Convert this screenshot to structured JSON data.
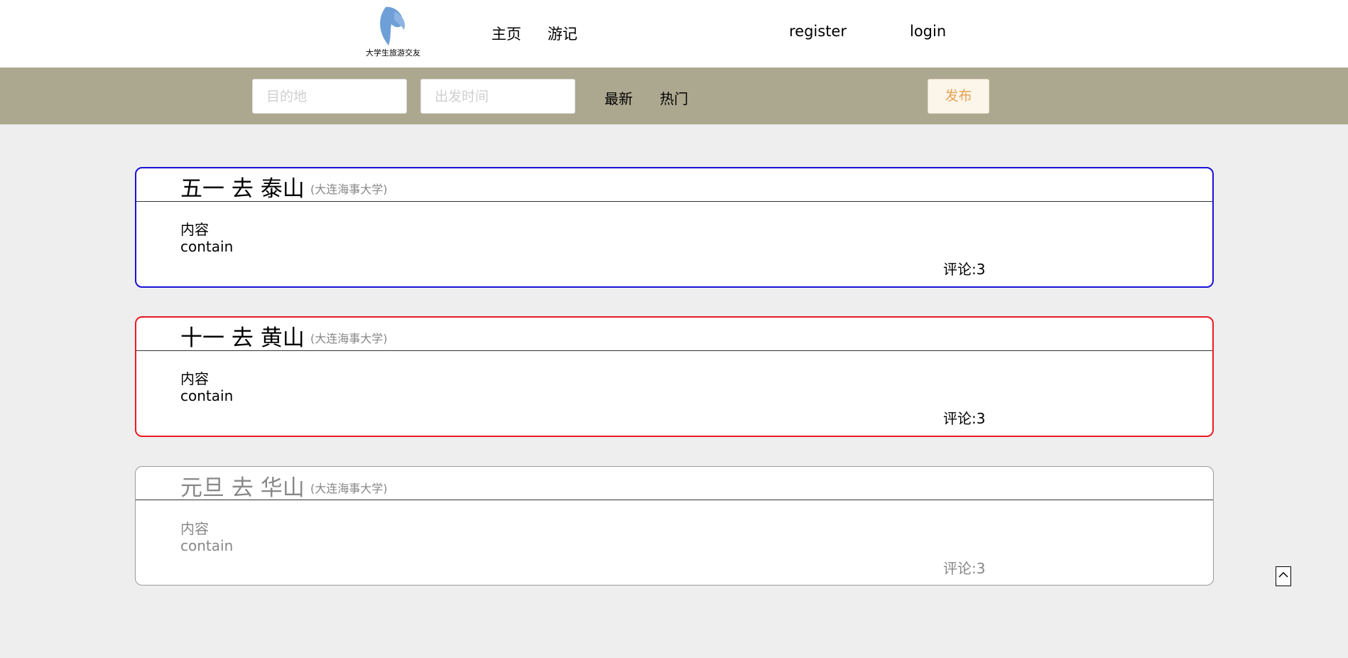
{
  "header": {
    "logo_text": "大学生旅游交友",
    "nav": [
      "主页",
      "游记"
    ],
    "register_label": "register",
    "login_label": "login"
  },
  "filter": {
    "destination_placeholder": "目的地",
    "departure_placeholder": "出发时间",
    "sort_latest": "最新",
    "sort_hot": "热门",
    "publish_label": "发布"
  },
  "posts": [
    {
      "title": "五一 去 泰山",
      "school": "(大连海事大学)",
      "content_label": "内容",
      "content": "contain",
      "comments": "评论:3",
      "border_color": "#1a12d6"
    },
    {
      "title": "十一 去 黄山",
      "school": "(大连海事大学)",
      "content_label": "内容",
      "content": "contain",
      "comments": "评论:3",
      "border_color": "#e81b23"
    },
    {
      "title": "元旦 去 华山",
      "school": "(大连海事大学)",
      "content_label": "内容",
      "content": "contain",
      "comments": "评论:3",
      "border_color": "#9a9a9a"
    }
  ],
  "back_to_top_icon": "chevron-up-icon"
}
